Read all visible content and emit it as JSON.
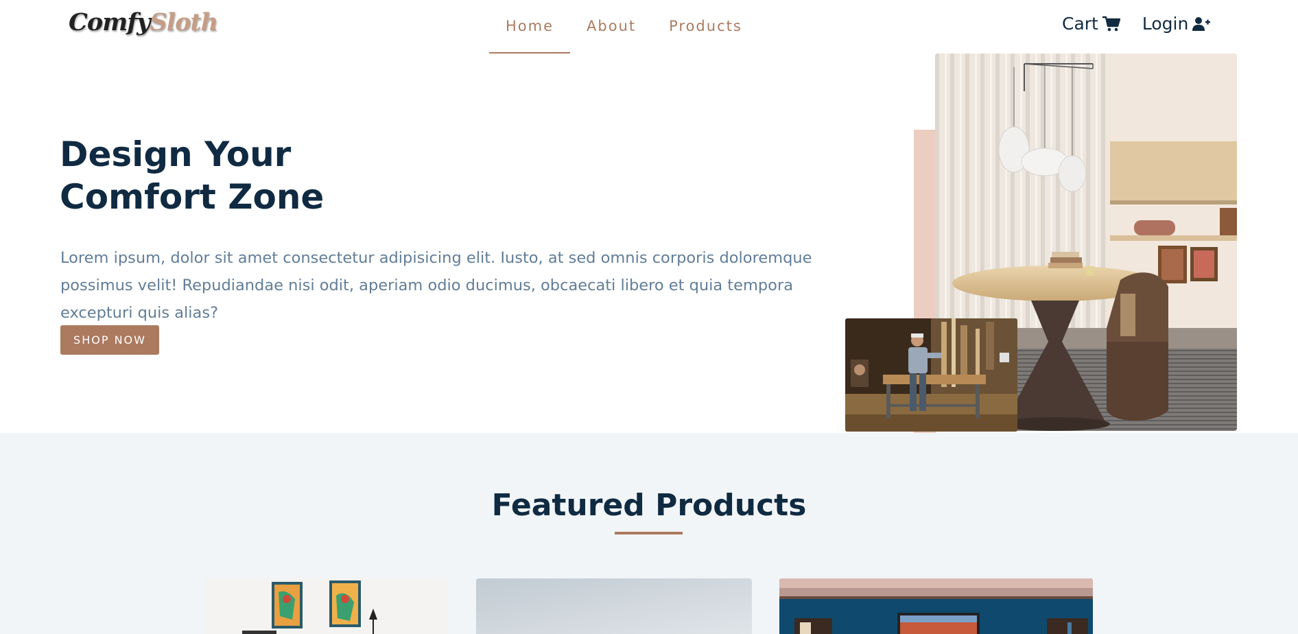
{
  "brand": {
    "part1": "Comfy",
    "part2": "Sloth"
  },
  "nav": {
    "links": [
      {
        "label": "Home",
        "active": true
      },
      {
        "label": "About",
        "active": false
      },
      {
        "label": "Products",
        "active": false
      }
    ],
    "cart_label": "Cart",
    "login_label": "Login"
  },
  "hero": {
    "title_line1": "Design Your",
    "title_line2": "Comfort Zone",
    "description": "Lorem ipsum, dolor sit amet consectetur adipisicing elit. Iusto, at sed omnis corporis doloremque possimus velit! Repudiandae nisi odit, aperiam odio ducimus, obcaecati libero et quia tempora excepturi quis alias?",
    "cta_label": "SHOP NOW"
  },
  "featured": {
    "title": "Featured Products"
  },
  "icons": {
    "cart": "cart-icon",
    "login": "user-plus-icon"
  },
  "colors": {
    "primary": "#ab7a5f",
    "heading": "#102a42",
    "body_text": "#617d98",
    "accent_block": "#ebcdc2",
    "section_bg": "#f1f5f8"
  }
}
